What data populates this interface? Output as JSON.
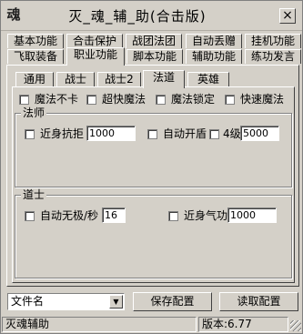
{
  "window": {
    "title": "灭_魂_辅_助(合击版)",
    "app_icon": "魂",
    "close_glyph": "×"
  },
  "main_tabs": {
    "row1": [
      "基本功能",
      "合击保护",
      "战团法团",
      "自动丢赠",
      "挂机功能"
    ],
    "row2": [
      "飞取装备",
      "职业功能",
      "脚本功能",
      "辅助功能",
      "练功发言"
    ],
    "active": "职业功能"
  },
  "sub_tabs": {
    "items": [
      "通用",
      "战士",
      "战士2",
      "法道",
      "英雄"
    ],
    "active": "法道"
  },
  "magic_options": [
    "魔法不卡",
    "超快魔法",
    "魔法锁定",
    "快速魔法"
  ],
  "mage": {
    "title": "法师",
    "melee_repel_label": "近身抗拒",
    "melee_repel_value": "1000",
    "auto_shield_label": "自动开盾",
    "level4_label": "4级",
    "level4_value": "5000"
  },
  "taoist": {
    "title": "道士",
    "auto_invis_label": "自动无极/秒",
    "auto_invis_value": "16",
    "melee_qigong_label": "近身气功",
    "melee_qigong_value": "1000"
  },
  "bottom": {
    "file_select_value": "文件名",
    "save_label": "保存配置",
    "load_label": "读取配置"
  },
  "status": {
    "app_name": "灭魂辅助",
    "version": "版本:6.77"
  }
}
